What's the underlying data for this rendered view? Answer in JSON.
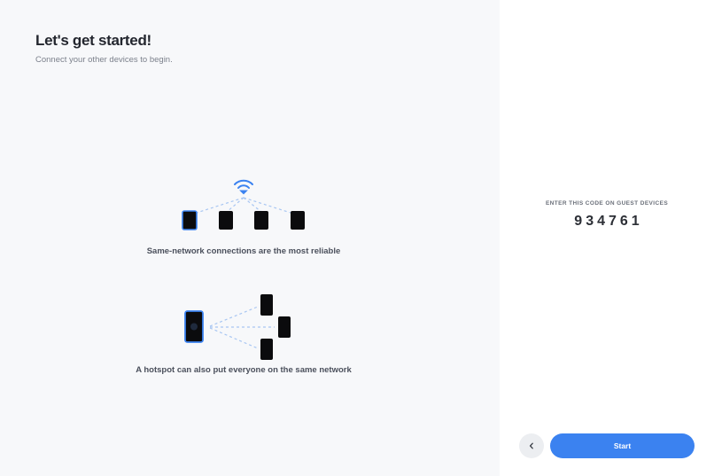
{
  "intro": {
    "title": "Let's get started!",
    "subtitle": "Connect your other devices to begin."
  },
  "illustrations": [
    {
      "caption": "Same-network connections are the most reliable",
      "icon": "wifi-icon"
    },
    {
      "caption": "A hotspot can also put everyone on the same network",
      "icon": "hotspot-phone-icon"
    }
  ],
  "pairing": {
    "label": "ENTER THIS CODE ON GUEST DEVICES",
    "code": "934761"
  },
  "footer": {
    "back_icon": "chevron-left-icon",
    "start_label": "Start"
  },
  "colors": {
    "accent": "#3b82f0",
    "left_panel_bg": "#f7f8fa",
    "device": "#0b0b0d",
    "dashed_line": "#a8c6f2"
  }
}
